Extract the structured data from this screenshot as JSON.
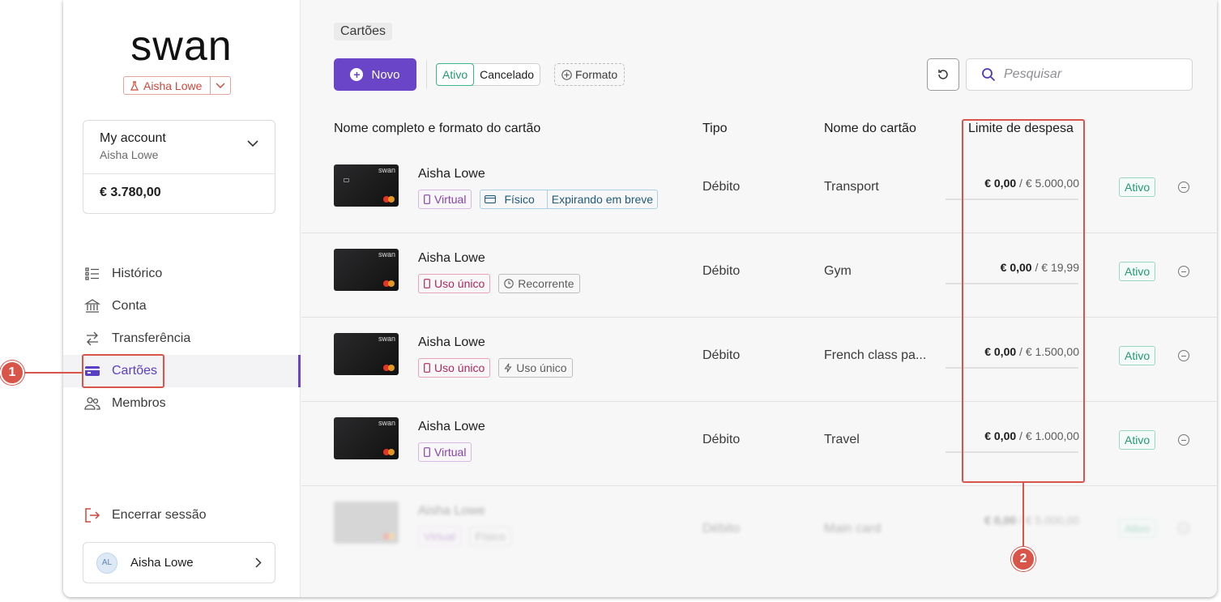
{
  "sidebar": {
    "logo": "swan",
    "project": "Aisha Lowe",
    "account": {
      "title": "My account",
      "holder": "Aisha Lowe",
      "balance": "€ 3.780,00"
    },
    "nav": [
      "Histórico",
      "Conta",
      "Transferência",
      "Cartões",
      "Membros"
    ],
    "active_nav": "Cartões",
    "logout": "Encerrar sessão",
    "user": {
      "initials": "AL",
      "name": "Aisha Lowe"
    }
  },
  "main": {
    "breadcrumb": "Cartões",
    "new_button": "Novo",
    "filter": {
      "active": "Ativo",
      "inactive": "Cancelado"
    },
    "format_filter": "Formato",
    "search_placeholder": "Pesquisar",
    "columns": [
      "Nome completo e formato do cartão",
      "Tipo",
      "Nome do cartão",
      "Limite de despesa"
    ],
    "rows": [
      {
        "holder": "Aisha Lowe",
        "tags": [
          "Virtual",
          "Físico",
          "Expirando em breve"
        ],
        "type": "Débito",
        "card_name": "Transport",
        "spent": "€ 0,00",
        "limit": "/ € 5.000,00",
        "status": "Ativo"
      },
      {
        "holder": "Aisha Lowe",
        "tags": [
          "Uso único",
          "Recorrente"
        ],
        "type": "Débito",
        "card_name": "Gym",
        "spent": "€ 0,00",
        "limit": "/ € 19,99",
        "status": "Ativo"
      },
      {
        "holder": "Aisha Lowe",
        "tags": [
          "Uso único",
          "Uso único"
        ],
        "type": "Débito",
        "card_name": "French class pa...",
        "spent": "€ 0,00",
        "limit": "/ € 1.500,00",
        "status": "Ativo"
      },
      {
        "holder": "Aisha Lowe",
        "tags": [
          "Virtual"
        ],
        "type": "Débito",
        "card_name": "Travel",
        "spent": "€ 0,00",
        "limit": "/ € 1.000,00",
        "status": "Ativo"
      },
      {
        "holder": "Aisha Lowe",
        "tags": [
          "Virtual",
          "Físico"
        ],
        "type": "Débito",
        "card_name": "Main card",
        "spent": "€ 0,00",
        "limit": "/ € 5.000,00",
        "status": "Ativo"
      }
    ]
  },
  "callouts": [
    "1",
    "2"
  ],
  "colors": {
    "accent": "#6a45c8",
    "highlight": "#d9554a",
    "active_status": "#239a6f"
  },
  "card_brand": "swan"
}
